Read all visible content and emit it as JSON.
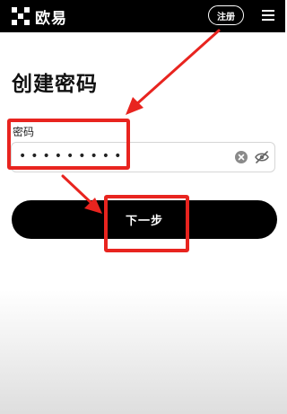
{
  "header": {
    "brand_name": "欧易",
    "register_label": "注册",
    "logo_icon": "okx-logo-icon",
    "menu_icon": "hamburger-menu-icon"
  },
  "page": {
    "title": "创建密码"
  },
  "password": {
    "label": "密码",
    "masked_value": "•••••••••",
    "clear_icon": "clear-icon",
    "visibility_icon": "eye-off-icon"
  },
  "actions": {
    "next_label": "下一步"
  },
  "annotation_color": "#e8241f"
}
